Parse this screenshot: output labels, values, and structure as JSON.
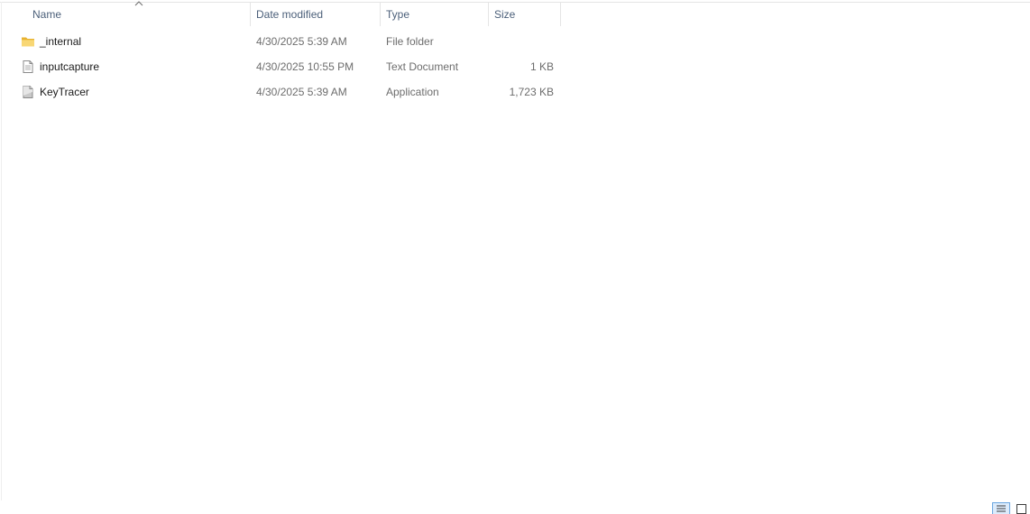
{
  "columns": {
    "name": "Name",
    "date_modified": "Date modified",
    "type": "Type",
    "size": "Size"
  },
  "sort": {
    "column": "name",
    "icon": "chevron-up-icon"
  },
  "files": [
    {
      "name": "_internal",
      "date_modified": "4/30/2025 5:39 AM",
      "type": "File folder",
      "size": "",
      "icon": "folder-icon"
    },
    {
      "name": "inputcapture",
      "date_modified": "4/30/2025 10:55 PM",
      "type": "Text Document",
      "size": "1 KB",
      "icon": "text-document-icon"
    },
    {
      "name": "KeyTracer",
      "date_modified": "4/30/2025 5:39 AM",
      "type": "Application",
      "size": "1,723 KB",
      "icon": "application-icon"
    }
  ],
  "view_modes": {
    "active": "details",
    "icons": [
      "details-view-icon",
      "large-icons-view-icon"
    ]
  },
  "colors": {
    "header_text": "#4c607a",
    "secondary_text": "#6d6d6d",
    "folder_yellow": "#f5c542",
    "active_view_border": "#6aa6e0"
  }
}
